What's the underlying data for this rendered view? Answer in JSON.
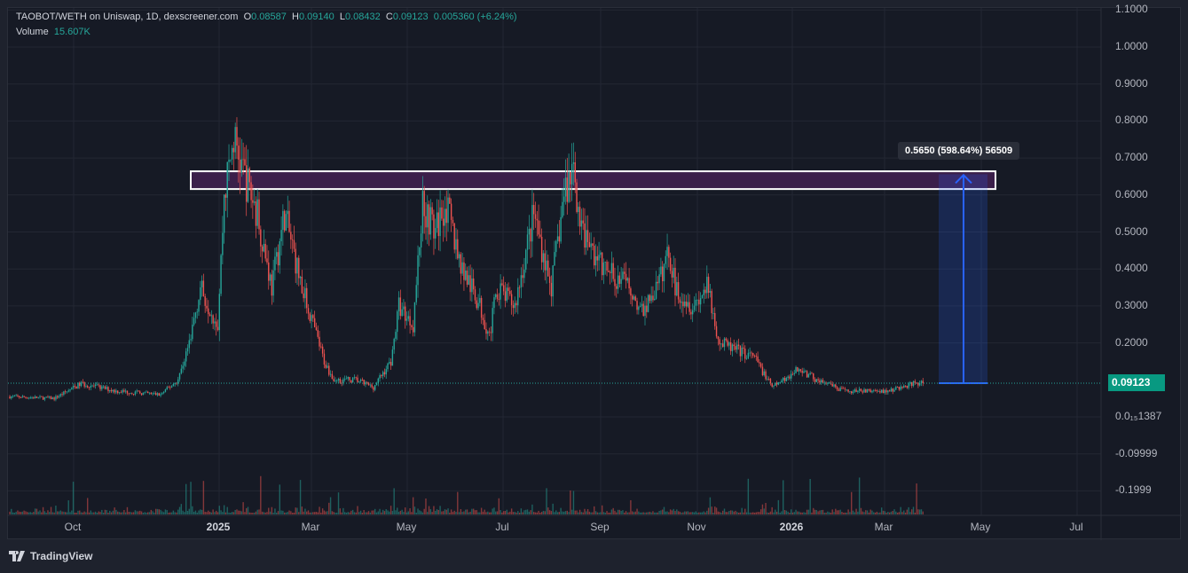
{
  "legend": {
    "title": "TAOBOT/WETH on Uniswap, 1D, dexscreener.com",
    "open_label": "O",
    "open": "0.08587",
    "high_label": "H",
    "high": "0.09140",
    "low_label": "L",
    "low": "0.08432",
    "close_label": "C",
    "close": "0.09123",
    "change": "0.005360 (+6.24%)",
    "volume_label": "Volume",
    "volume": "15.607K"
  },
  "price_axis": [
    "1.1000",
    "1.0000",
    "0.9000",
    "0.8000",
    "0.7000",
    "0.6000",
    "0.5000",
    "0.4000",
    "0.3000",
    "0.2000",
    "0.0₁₅1387",
    "-0.09999",
    "-0.1999"
  ],
  "current_price": "0.09123",
  "time_axis": [
    {
      "label": "Oct",
      "bold": false
    },
    {
      "label": "2025",
      "bold": true
    },
    {
      "label": "Mar",
      "bold": false
    },
    {
      "label": "May",
      "bold": false
    },
    {
      "label": "Jul",
      "bold": false
    },
    {
      "label": "Sep",
      "bold": false
    },
    {
      "label": "Nov",
      "bold": false
    },
    {
      "label": "2026",
      "bold": true
    },
    {
      "label": "Mar",
      "bold": false
    },
    {
      "label": "May",
      "bold": false
    },
    {
      "label": "Jul",
      "bold": false
    }
  ],
  "measure": {
    "label": "0.5650 (598.64%) 56509",
    "from": 0.0912,
    "to": 0.656
  },
  "zone": {
    "low": 0.616,
    "high": 0.664
  },
  "colors": {
    "up": "#26a69a",
    "down": "#ef5350",
    "zone": "#3b1f4a",
    "measure": "#2962ff"
  },
  "footer": {
    "brand": "TradingView"
  },
  "chart_data": {
    "type": "candlestick",
    "start_date": "2024-08-22",
    "price_anchors": [
      [
        0,
        0.055
      ],
      [
        28,
        0.05
      ],
      [
        45,
        0.09
      ],
      [
        67,
        0.07
      ],
      [
        95,
        0.06
      ],
      [
        106,
        0.1
      ],
      [
        113,
        0.2
      ],
      [
        120,
        0.35
      ],
      [
        131,
        0.25
      ],
      [
        135,
        0.6
      ],
      [
        141,
        0.75
      ],
      [
        148,
        0.65
      ],
      [
        156,
        0.55
      ],
      [
        165,
        0.35
      ],
      [
        173,
        0.55
      ],
      [
        184,
        0.35
      ],
      [
        198,
        0.15
      ],
      [
        204,
        0.1
      ],
      [
        218,
        0.1
      ],
      [
        229,
        0.08
      ],
      [
        240,
        0.15
      ],
      [
        245,
        0.3
      ],
      [
        254,
        0.25
      ],
      [
        260,
        0.58
      ],
      [
        268,
        0.5
      ],
      [
        274,
        0.58
      ],
      [
        285,
        0.4
      ],
      [
        296,
        0.3
      ],
      [
        302,
        0.22
      ],
      [
        307,
        0.35
      ],
      [
        318,
        0.3
      ],
      [
        330,
        0.55
      ],
      [
        341,
        0.35
      ],
      [
        349,
        0.6
      ],
      [
        355,
        0.68
      ],
      [
        360,
        0.5
      ],
      [
        374,
        0.4
      ],
      [
        391,
        0.35
      ],
      [
        397,
        0.28
      ],
      [
        408,
        0.35
      ],
      [
        415,
        0.45
      ],
      [
        419,
        0.35
      ],
      [
        430,
        0.3
      ],
      [
        439,
        0.35
      ],
      [
        447,
        0.2
      ],
      [
        458,
        0.18
      ],
      [
        469,
        0.16
      ],
      [
        480,
        0.08
      ],
      [
        497,
        0.13
      ],
      [
        508,
        0.1
      ],
      [
        525,
        0.07
      ],
      [
        553,
        0.07
      ],
      [
        570,
        0.09
      ],
      [
        575,
        0.0912
      ]
    ],
    "ylim": [
      -0.22,
      1.11
    ]
  }
}
